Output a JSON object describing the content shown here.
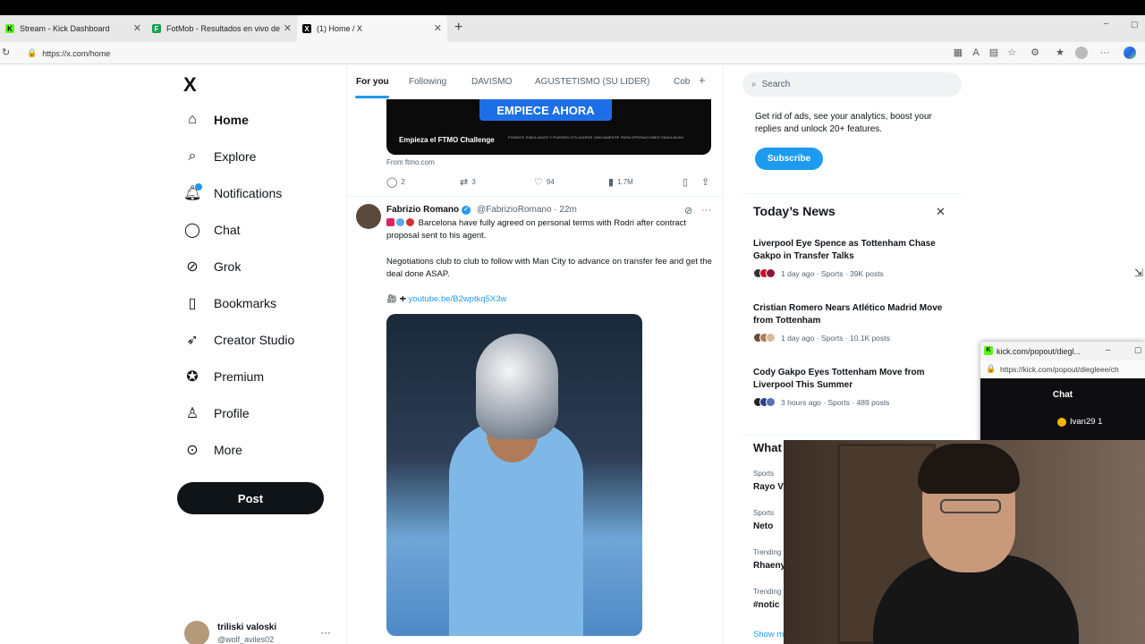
{
  "browser": {
    "tabs": [
      {
        "title": "Stream - Kick Dashboard",
        "fav": "K"
      },
      {
        "title": "FotMob - Resultados en vivo de fút",
        "fav": "F"
      },
      {
        "title": "(1) Home / X",
        "fav": "X"
      }
    ],
    "url": "https://x.com/home"
  },
  "nav": {
    "logo": "X",
    "items": [
      {
        "label": "Home",
        "icon": "home-icon"
      },
      {
        "label": "Explore",
        "icon": "search-icon"
      },
      {
        "label": "Notifications",
        "icon": "bell-icon"
      },
      {
        "label": "Chat",
        "icon": "chat-icon"
      },
      {
        "label": "Grok",
        "icon": "grok-icon"
      },
      {
        "label": "Bookmarks",
        "icon": "bookmark-icon"
      },
      {
        "label": "Creator Studio",
        "icon": "rocket-icon"
      },
      {
        "label": "Premium",
        "icon": "premium-icon"
      },
      {
        "label": "Profile",
        "icon": "person-icon"
      },
      {
        "label": "More",
        "icon": "more-circle-icon"
      }
    ],
    "post_label": "Post",
    "account": {
      "name": "triliski valoski",
      "handle": "@wolf_aviles02"
    }
  },
  "feed": {
    "tabs": [
      "For you",
      "Following",
      "DAVISMO",
      "AGUSTETISMO (SU LIDER)",
      "Cob"
    ],
    "add_tab": "+",
    "ad": {
      "button": "EMPIECE AHORA",
      "caption": "Empieza el FTMO Challenge",
      "small": "FONDOS SIMULADOS Y PUEDEN UTILIZARSE ÚNICAMENTE PARA OPERACIONES SIMULADAS.",
      "from": "From ftmo.com",
      "replies": "2",
      "reposts": "3",
      "likes": "94",
      "views": "1.7M"
    },
    "tweet": {
      "name": "Fabrizio Romano",
      "handle": "@FabrizioRomano · 22m",
      "line1": "Barcelona have fully agreed on personal terms with Rodri after contract proposal sent to his agent.",
      "line2": "Negotiations club to club to follow with Man City to advance on transfer fee and get the deal done ASAP.",
      "link": "youtube.be/B2wptkq5X3w"
    }
  },
  "right": {
    "search_placeholder": "Search",
    "premium_text": "Get rid of ads, see your analytics, boost your replies and unlock 20+ features.",
    "subscribe": "Subscribe",
    "news_title": "Today’s News",
    "news": [
      {
        "title": "Liverpool Eye Spence as Tottenham Chase Gakpo in Transfer Talks",
        "meta": "1 day ago · Sports · 39K posts"
      },
      {
        "title": "Cristian Romero Nears Atlético Madrid Move from Tottenham",
        "meta": "1 day ago · Sports · 10.1K posts"
      },
      {
        "title": "Cody Gakpo Eyes Tottenham Move from Liverpool This Summer",
        "meta": "3 hours ago · Sports · 489 posts"
      }
    ],
    "what_title": "What",
    "trends": [
      {
        "label": "Sports",
        "value": "Rayo V"
      },
      {
        "label": "Sports",
        "value": "Neto"
      },
      {
        "label": "Trending",
        "value": "Rhaeny"
      },
      {
        "label": "Trending",
        "value": "#notic"
      }
    ],
    "show_more": "Show m"
  },
  "popout": {
    "title": "kick.com/popout/diegl...",
    "url": "https://kick.com/popout/diegleee/ch",
    "chat": "Chat",
    "user": "Ivan29",
    "user_count": "1"
  }
}
